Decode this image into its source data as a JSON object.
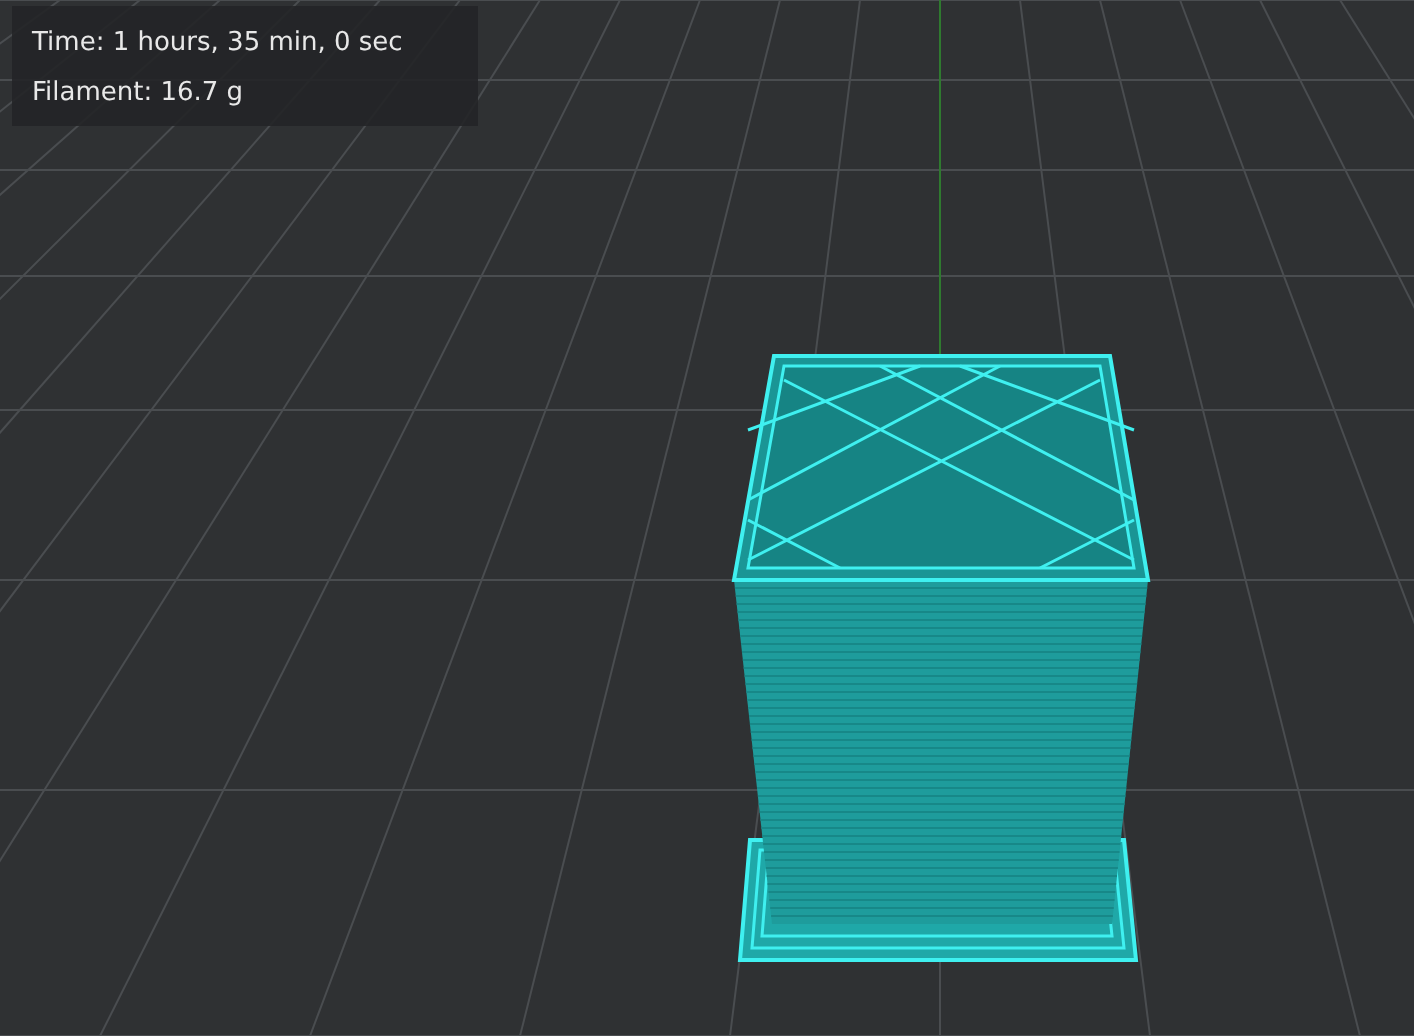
{
  "print_info": {
    "time": "Time: 1 hours, 35 min, 0 sec",
    "filament": "Filament: 16.7 g"
  }
}
